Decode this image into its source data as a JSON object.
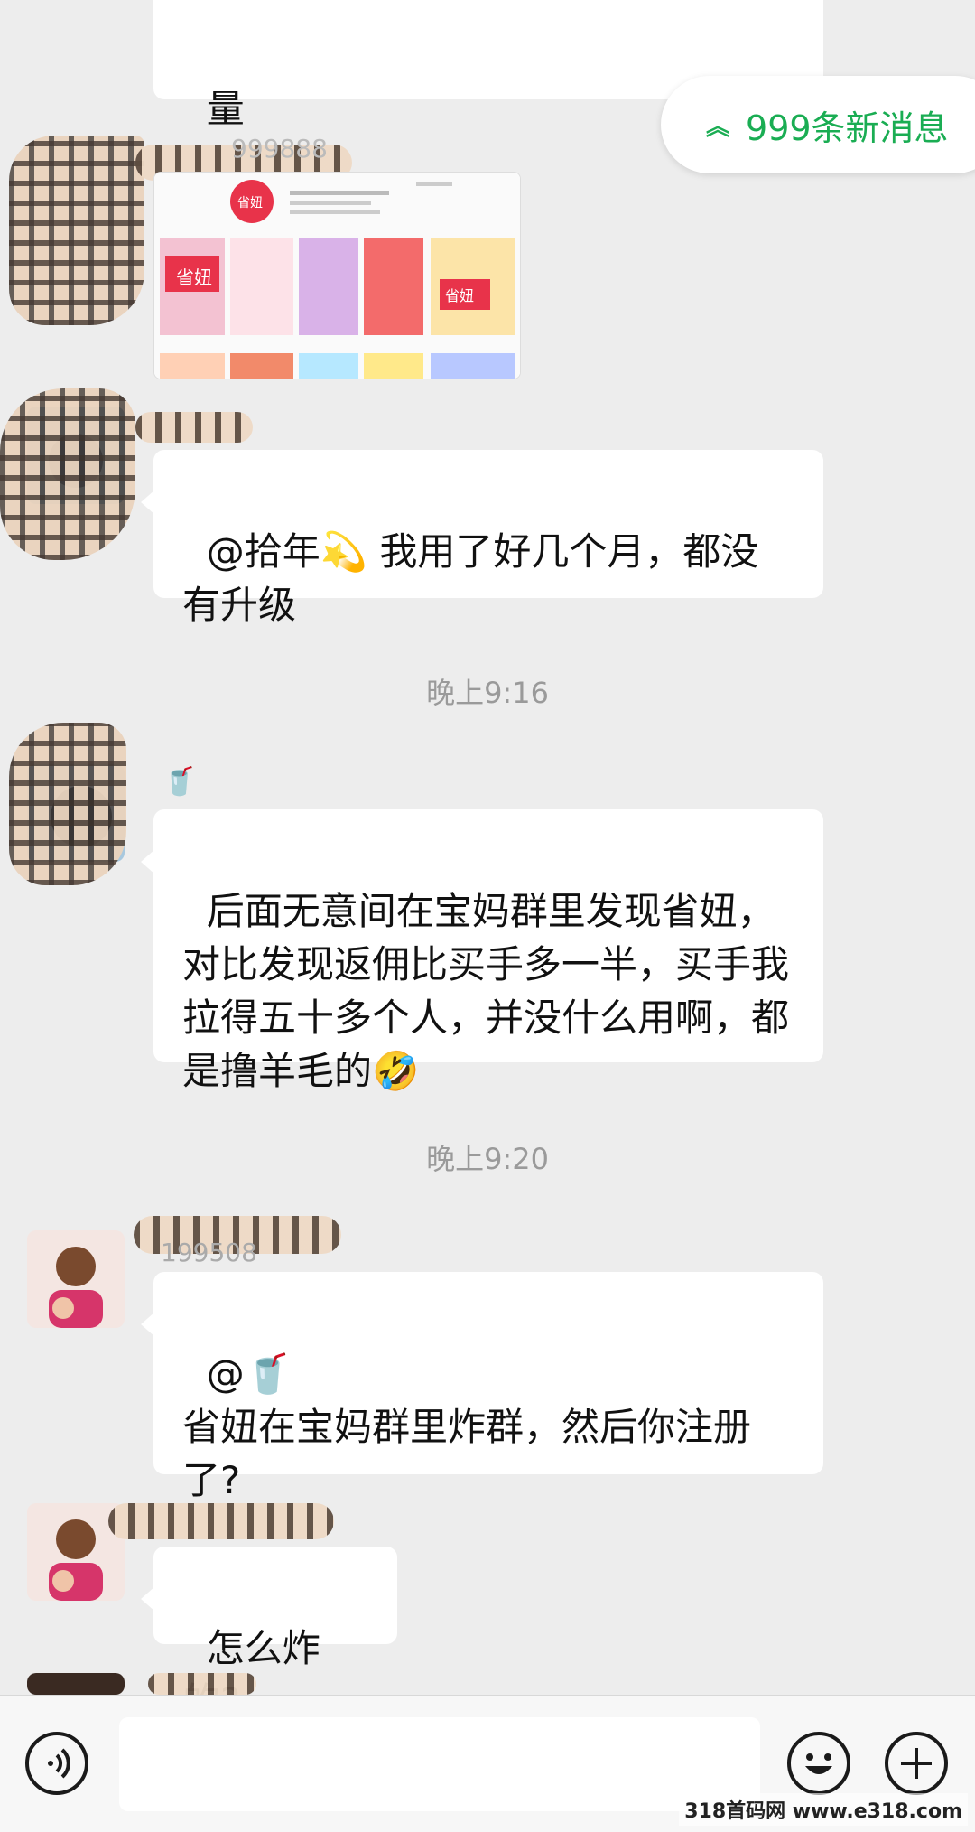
{
  "top_partial_bubble_text": "量",
  "new_messages_label": "999条新消息",
  "messages": [
    {
      "sender_partial": "999888"
    },
    {
      "text": "@拾年💫 我用了好几个月，都没有升级"
    },
    {
      "time": "晚上9:16"
    },
    {
      "sender_emoji": "🥤",
      "text": "后面无意间在宝妈群里发现省妞，对比发现返佣比买手多一半，买手我拉得五十多个人，并没什么用啊，都是撸羊毛的🤣"
    },
    {
      "time": "晚上9:20"
    },
    {
      "sender_partial": "199508",
      "text": "@🥤\n省妞在宝妈群里炸群，然后你注册了?"
    },
    {
      "text": "怎么炸的?"
    }
  ],
  "image_card": {
    "logo_text": "省妞",
    "tile_texts": [
      "省妞",
      "省妞"
    ]
  },
  "watermark": "318首码网 www.e318.com",
  "icons": [
    "chevron-up-double-icon",
    "voice-icon",
    "emoji-icon",
    "plus-icon"
  ],
  "colors": {
    "accent_green": "#1aad53",
    "background": "#ededed"
  }
}
